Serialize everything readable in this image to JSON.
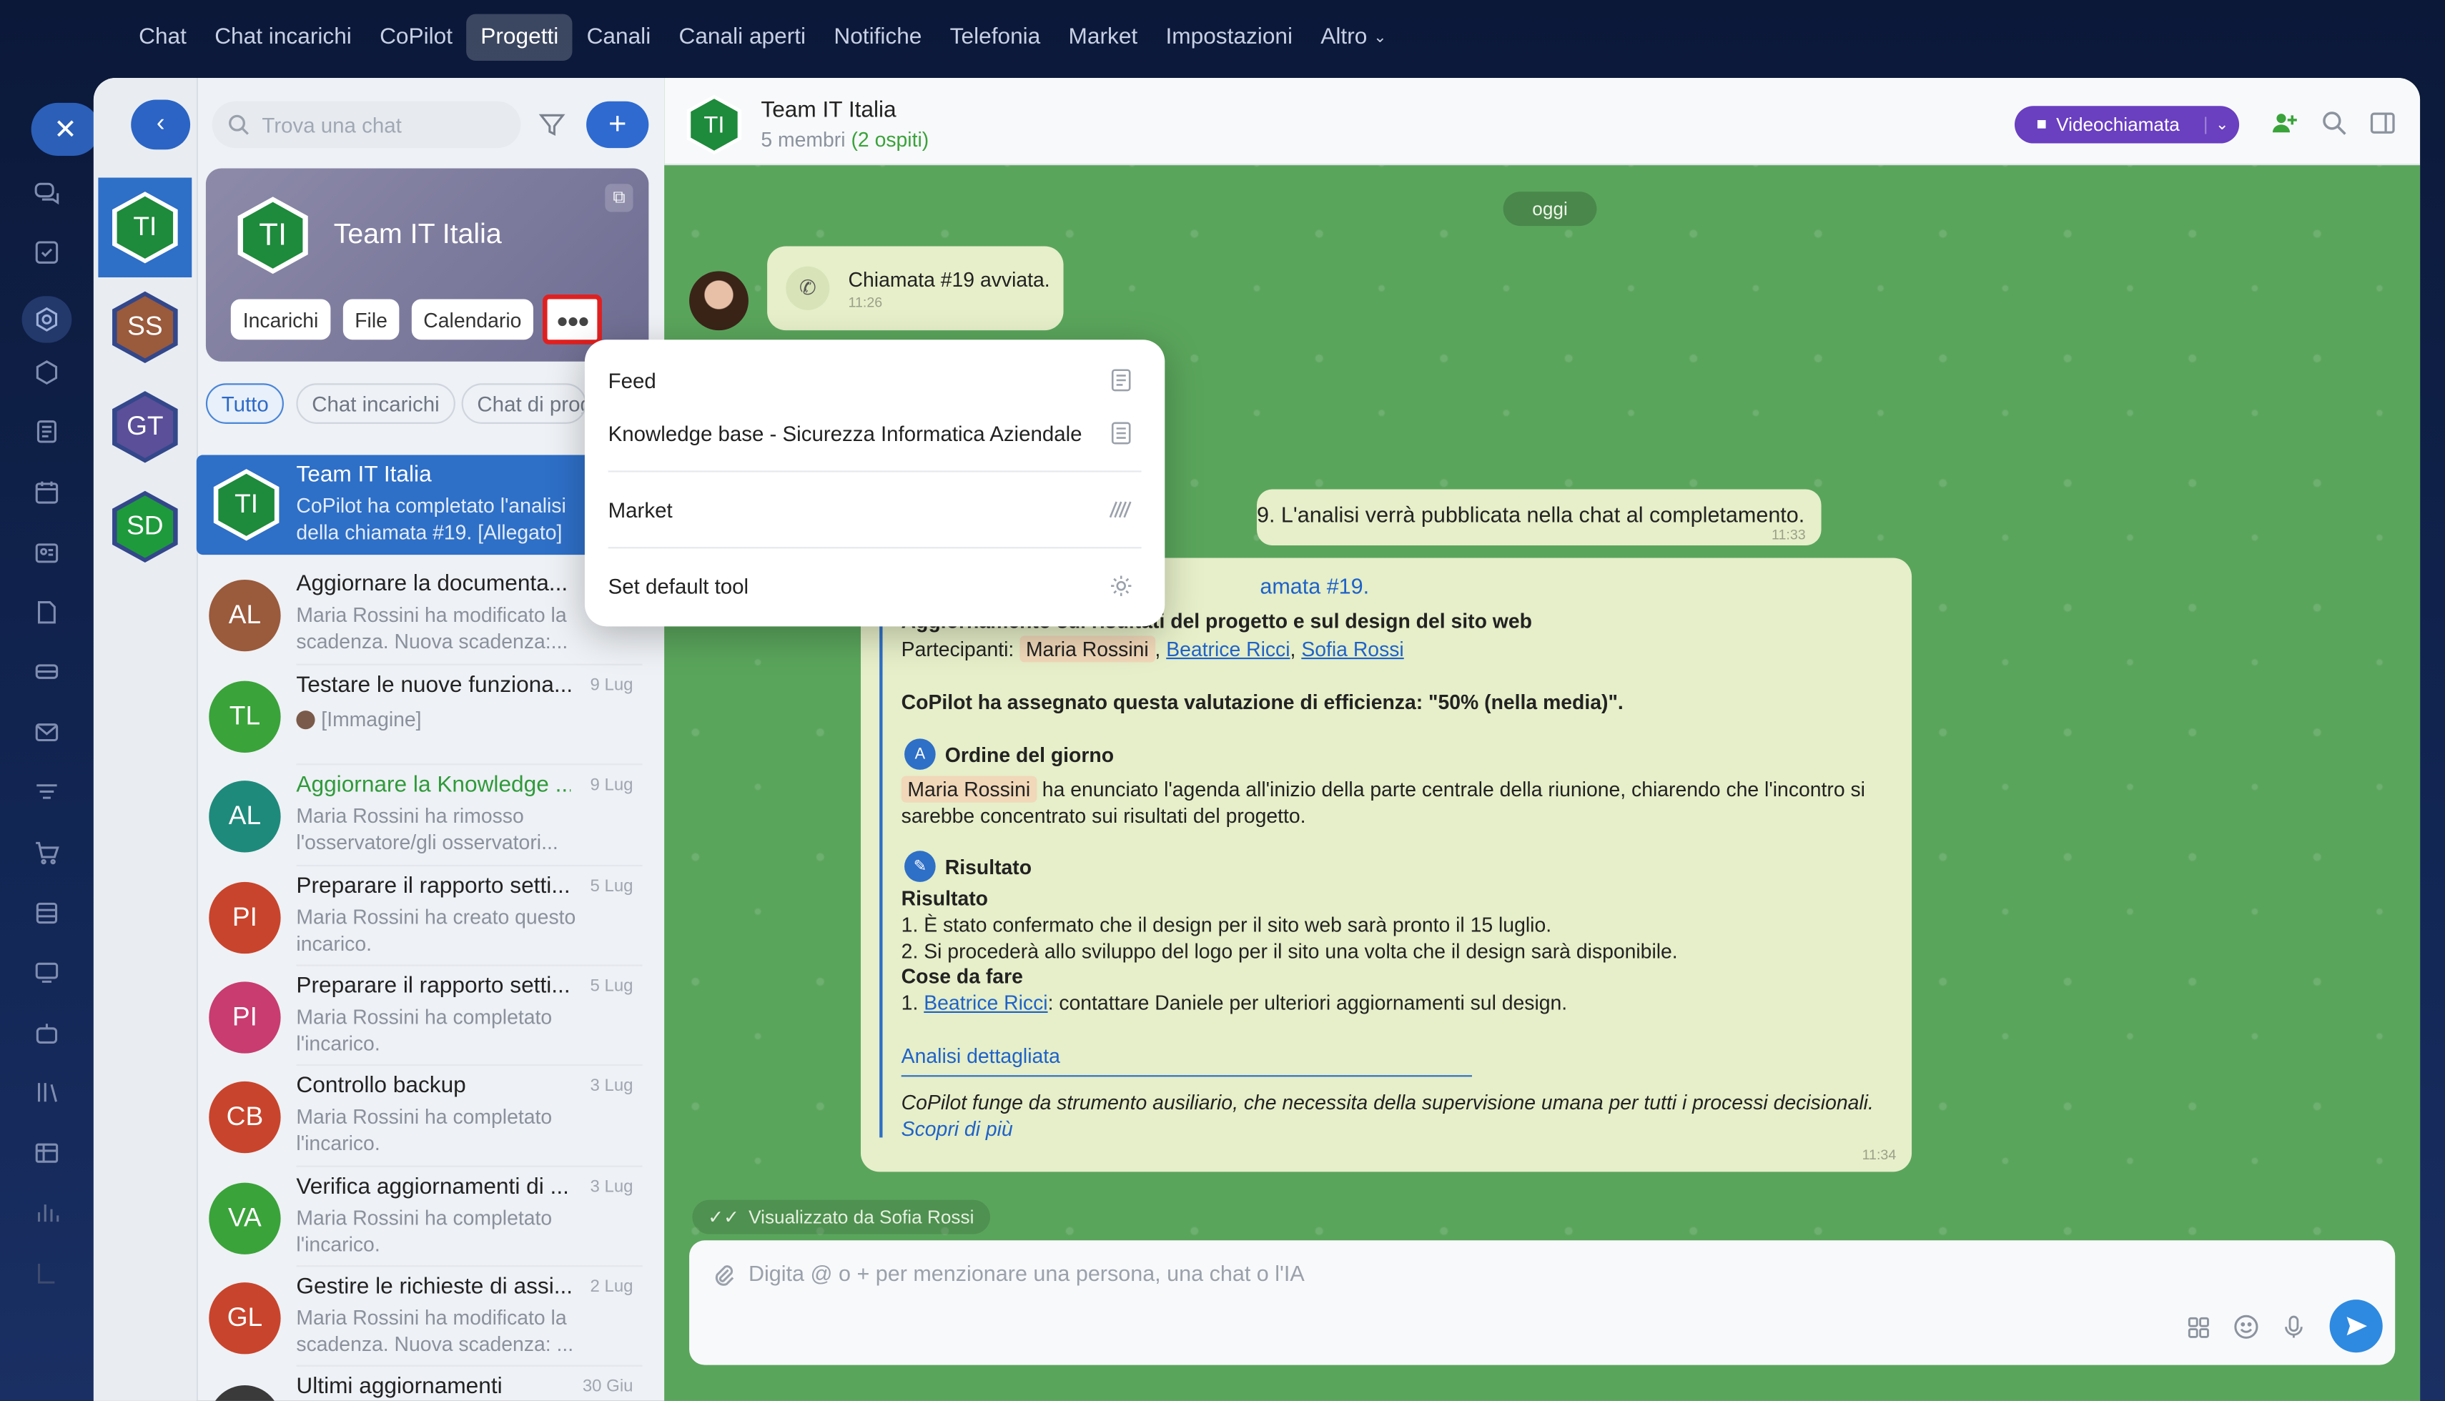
{
  "topnav": [
    "Chat",
    "Chat incarichi",
    "CoPilot",
    "Progetti",
    "Canali",
    "Canali aperti",
    "Notifiche",
    "Telefonia",
    "Market",
    "Impostazioni",
    "Altro"
  ],
  "search_placeholder": "Trova una chat",
  "group": {
    "initials": "TI",
    "name": "Team IT Italia",
    "buttons": [
      "Incarichi",
      "File",
      "Calendario"
    ]
  },
  "chips": [
    "Tutto",
    "Chat incarichi",
    "Chat di prog"
  ],
  "recent": [
    {
      "initials": "TI",
      "color": "#1e8a3c"
    },
    {
      "initials": "SS",
      "color": "#9a5a3c"
    },
    {
      "initials": "GT",
      "color": "#5a4f98"
    },
    {
      "initials": "SD",
      "color": "#1e9a3c"
    }
  ],
  "chats": [
    {
      "initials": "TI",
      "color": "#1e8a3c",
      "title": "Team IT Italia",
      "date": "",
      "sub1": "CoPilot ha completato l'analisi",
      "sub2": "della chiamata #19. [Allegato]"
    },
    {
      "initials": "AL",
      "color": "#9a5a3c",
      "title": "Aggiornare la documenta...",
      "date": "",
      "sub1": "Maria Rossini ha modificato la",
      "sub2": "scadenza. Nuova scadenza:..."
    },
    {
      "initials": "TL",
      "color": "#3aa33a",
      "title": "Testare le nuove funziona...",
      "date": "9 Lug",
      "sub1": "[Immagine]",
      "sub2": ""
    },
    {
      "initials": "AL",
      "color": "#1e8a7c",
      "title": "Aggiornare la Knowledge ...",
      "date": "9 Lug",
      "sub1": "Maria Rossini ha rimosso",
      "sub2": "l'osservatore/gli osservatori..."
    },
    {
      "initials": "PI",
      "color": "#c8442c",
      "title": "Preparare il rapporto setti...",
      "date": "5 Lug",
      "sub1": "Maria Rossini ha creato questo",
      "sub2": "incarico."
    },
    {
      "initials": "PI",
      "color": "#c83c70",
      "title": "Preparare il rapporto setti...",
      "date": "5 Lug",
      "sub1": "Maria Rossini ha completato",
      "sub2": "l'incarico."
    },
    {
      "initials": "CB",
      "color": "#c8442c",
      "title": "Controllo backup",
      "date": "3 Lug",
      "sub1": "Maria Rossini ha completato",
      "sub2": "l'incarico."
    },
    {
      "initials": "VA",
      "color": "#3aa33a",
      "title": "Verifica aggiornamenti di ...",
      "date": "3 Lug",
      "sub1": "Maria Rossini ha completato",
      "sub2": "l'incarico."
    },
    {
      "initials": "GL",
      "color": "#c8442c",
      "title": "Gestire le richieste di assi...",
      "date": "2 Lug",
      "sub1": "Maria Rossini ha modificato la",
      "sub2": "scadenza. Nuova scadenza: ..."
    },
    {
      "initials": "",
      "color": "#3a3a3a",
      "title": "Ultimi aggiornamenti",
      "date": "30 Giu",
      "sub1": "",
      "sub2": ""
    }
  ],
  "header": {
    "title": "Team IT Italia",
    "members": "5 membri",
    "guests": "(2 ospiti)",
    "video": "Videochiamata"
  },
  "today": "oggi",
  "call": {
    "text": "Chiamata #19 avviata.",
    "time": "11:26"
  },
  "msg2": {
    "text": "9. L'analisi verrà pubblicata nella chat al completamento.",
    "time": "11:33"
  },
  "copilot": {
    "link": "amata #19.",
    "subject": "Aggiornamento sui risultati del progetto e sul design del sito web",
    "participants_label": "Partecipanti:",
    "p1": "Maria Rossini",
    "p2": "Beatrice Ricci",
    "p3": "Sofia Rossi",
    "eval": "CoPilot ha assegnato questa valutazione di efficienza: \"50% (nella media)\".",
    "agenda_title": "Ordine del giorno",
    "agenda_tag": "Maria Rossini",
    "agenda_line1": "ha enunciato l'agenda all'inizio della parte centrale della riunione, chiarendo che l'incontro si",
    "agenda_line2": "sarebbe concentrato sui risultati del progetto.",
    "result_title": "Risultato",
    "result_sub": "Risultato",
    "r1": "1. È stato confermato che il design per il sito web sarà pronto il 15 luglio.",
    "r2": "2. Si procederà allo sviluppo del logo per il sito una volta che il design sarà disponibile.",
    "todo_title": "Cose da fare",
    "todo_num": "1.",
    "todo_name": "Beatrice Ricci",
    "todo_text": ": contattare Daniele per ulteriori aggiornamenti sul design.",
    "detail": "Analisi dettagliata",
    "disclaimer": "CoPilot funge da strumento ausiliario, che necessita della supervisione umana per tutti i processi decisionali.",
    "more": "Scopri di più",
    "time": "11:34"
  },
  "seen": "Visualizzato da Sofia Rossi",
  "input_placeholder": "Digita @ o + per menzionare una persona, una chat o l'IA",
  "menu": [
    "Feed",
    "Knowledge base - Sicurezza Informatica Aziendale",
    "Market",
    "Set default tool"
  ]
}
